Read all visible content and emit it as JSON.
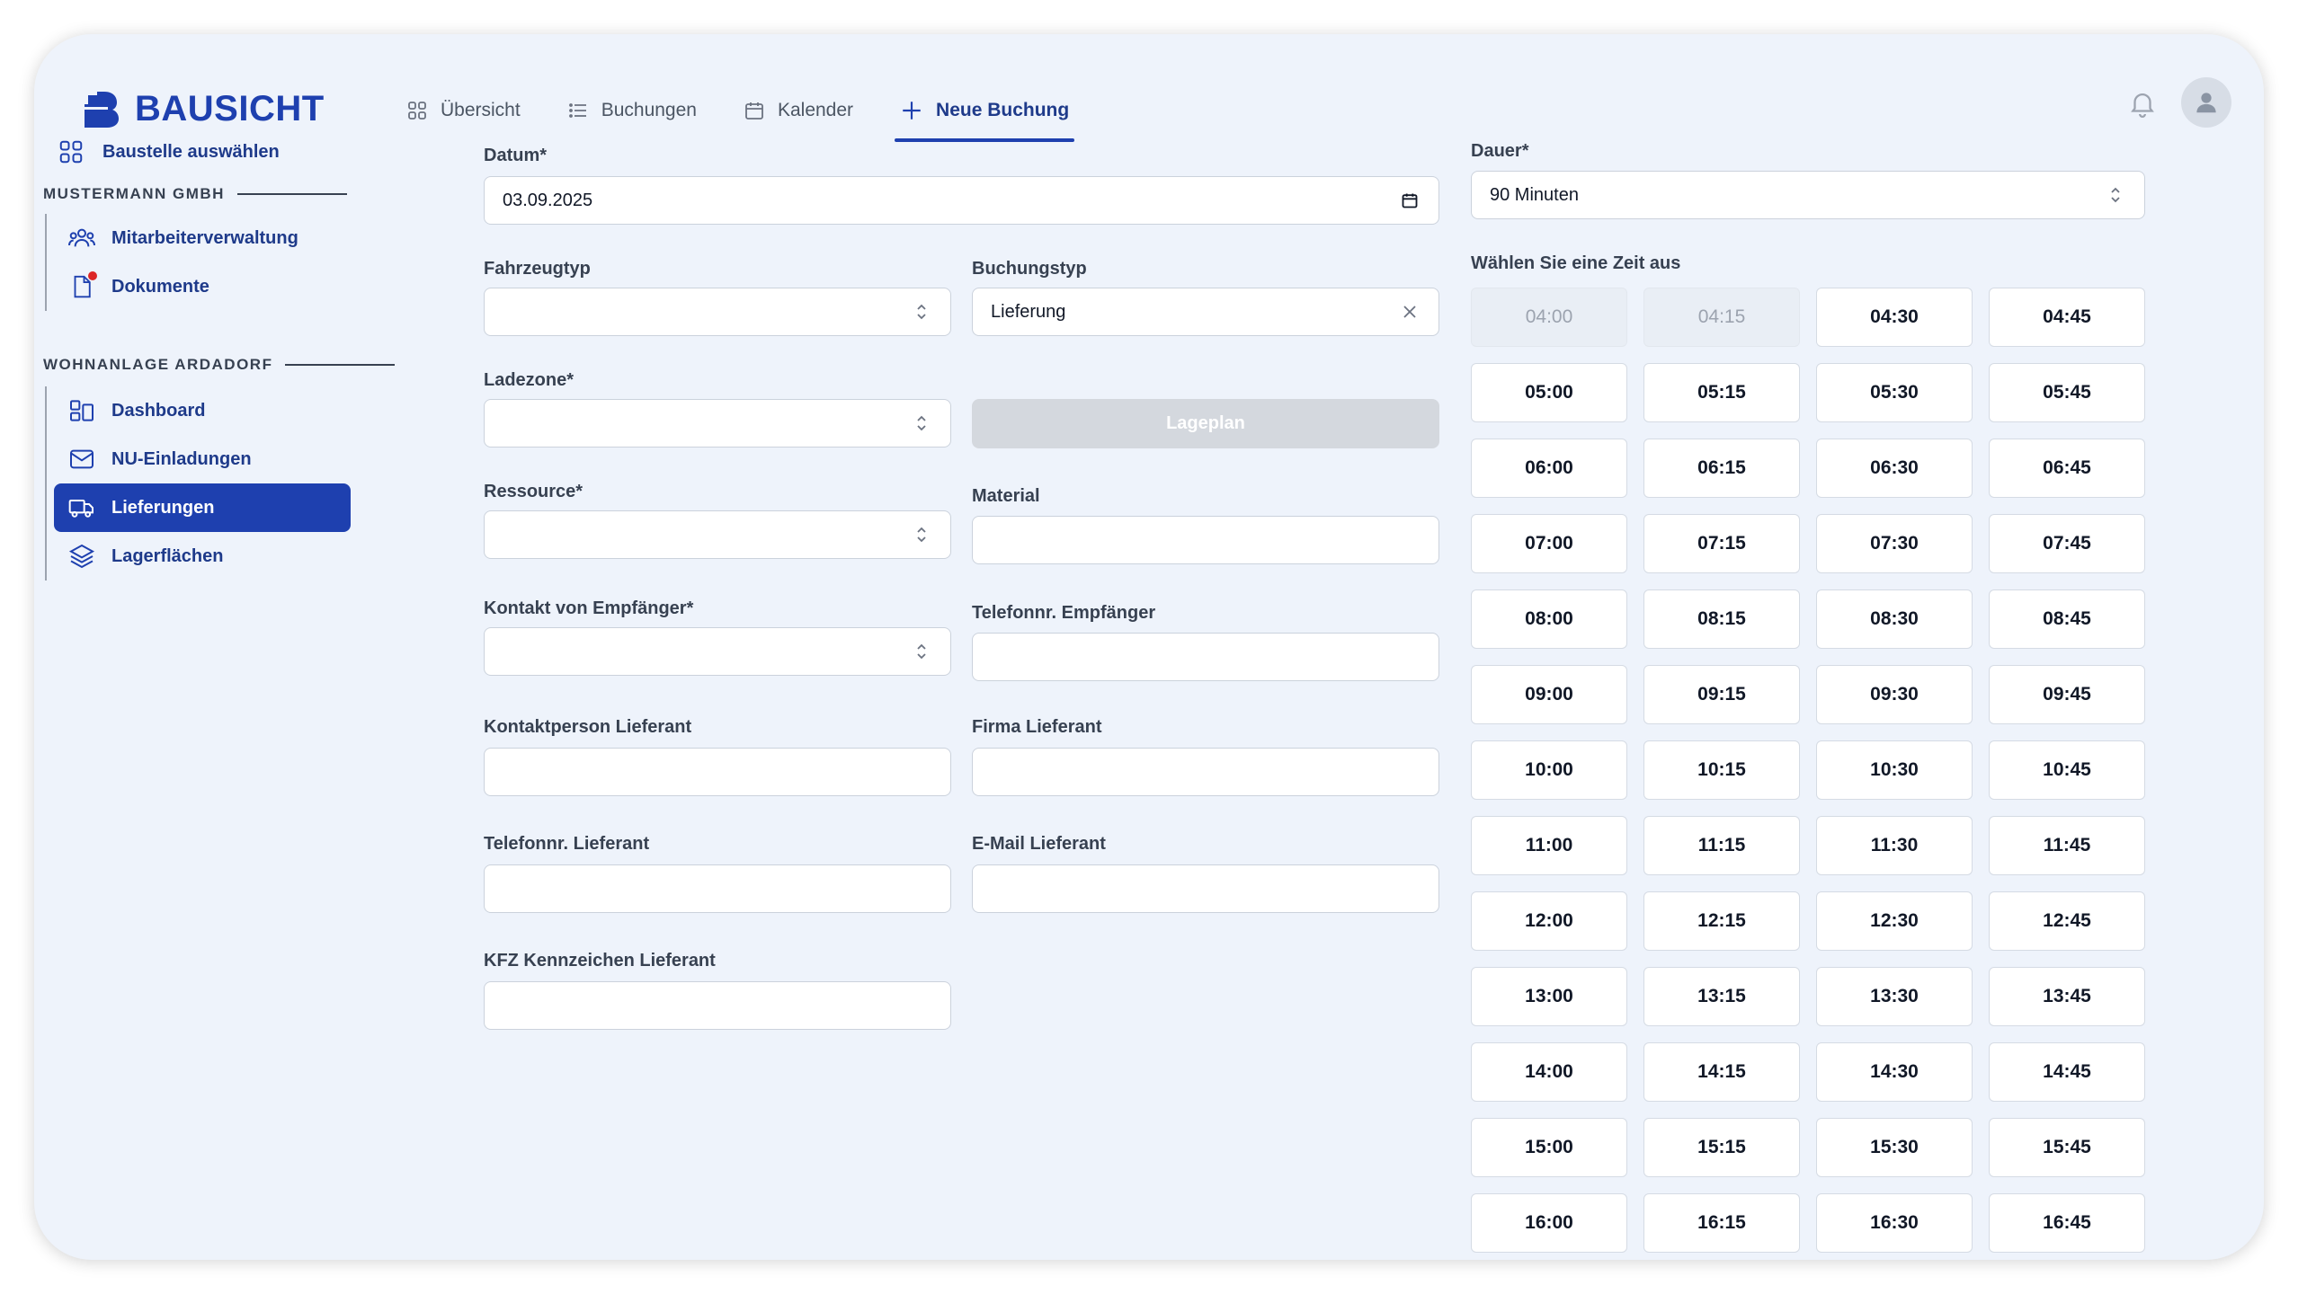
{
  "header": {
    "brand": "BAUSICHT",
    "tabs": [
      {
        "label": "Übersicht",
        "icon": "grid-icon"
      },
      {
        "label": "Buchungen",
        "icon": "list-icon"
      },
      {
        "label": "Kalender",
        "icon": "calendar-icon"
      },
      {
        "label": "Neue Buchung",
        "icon": "plus-icon",
        "active": true
      }
    ]
  },
  "sidebar": {
    "top_link": "Baustelle auswählen",
    "sections": [
      {
        "title": "MUSTERMANN GMBH",
        "items": [
          {
            "label": "Mitarbeiterverwaltung",
            "icon": "users-icon"
          },
          {
            "label": "Dokumente",
            "icon": "document-icon",
            "badge": true
          }
        ]
      },
      {
        "title": "WOHNANLAGE ARDADORF",
        "items": [
          {
            "label": "Dashboard",
            "icon": "dashboard-icon"
          },
          {
            "label": "NU-Einladungen",
            "icon": "mail-icon"
          },
          {
            "label": "Lieferungen",
            "icon": "truck-icon",
            "active": true
          },
          {
            "label": "Lagerflächen",
            "icon": "layers-icon"
          }
        ]
      }
    ]
  },
  "form": {
    "datum": {
      "label": "Datum*",
      "value": "03.09.2025"
    },
    "fahrzeugtyp": {
      "label": "Fahrzeugtyp",
      "value": ""
    },
    "buchungstyp": {
      "label": "Buchungstyp",
      "value": "Lieferung"
    },
    "ladezone": {
      "label": "Ladezone*",
      "value": ""
    },
    "lageplan_button": "Lageplan",
    "ressource": {
      "label": "Ressource*",
      "value": ""
    },
    "material": {
      "label": "Material",
      "value": ""
    },
    "kontakt_empfaenger": {
      "label": "Kontakt von Empfänger*",
      "value": ""
    },
    "telefon_empfaenger": {
      "label": "Telefonnr. Empfänger",
      "value": ""
    },
    "kontaktperson_lieferant": {
      "label": "Kontaktperson Lieferant",
      "value": ""
    },
    "firma_lieferant": {
      "label": "Firma Lieferant",
      "value": ""
    },
    "telefon_lieferant": {
      "label": "Telefonnr. Lieferant",
      "value": ""
    },
    "email_lieferant": {
      "label": "E-Mail Lieferant",
      "value": ""
    },
    "kfz_kennzeichen": {
      "label": "KFZ Kennzeichen Lieferant",
      "value": ""
    }
  },
  "schedule": {
    "dauer_label": "Dauer*",
    "dauer_value": "90 Minuten",
    "time_label": "Wählen Sie eine Zeit aus",
    "slots": [
      {
        "t": "04:00",
        "disabled": true
      },
      {
        "t": "04:15",
        "disabled": true
      },
      {
        "t": "04:30"
      },
      {
        "t": "04:45"
      },
      {
        "t": "05:00"
      },
      {
        "t": "05:15"
      },
      {
        "t": "05:30"
      },
      {
        "t": "05:45"
      },
      {
        "t": "06:00"
      },
      {
        "t": "06:15"
      },
      {
        "t": "06:30"
      },
      {
        "t": "06:45"
      },
      {
        "t": "07:00"
      },
      {
        "t": "07:15"
      },
      {
        "t": "07:30"
      },
      {
        "t": "07:45"
      },
      {
        "t": "08:00"
      },
      {
        "t": "08:15"
      },
      {
        "t": "08:30"
      },
      {
        "t": "08:45"
      },
      {
        "t": "09:00"
      },
      {
        "t": "09:15"
      },
      {
        "t": "09:30"
      },
      {
        "t": "09:45"
      },
      {
        "t": "10:00"
      },
      {
        "t": "10:15"
      },
      {
        "t": "10:30"
      },
      {
        "t": "10:45"
      },
      {
        "t": "11:00"
      },
      {
        "t": "11:15"
      },
      {
        "t": "11:30"
      },
      {
        "t": "11:45"
      },
      {
        "t": "12:00"
      },
      {
        "t": "12:15"
      },
      {
        "t": "12:30"
      },
      {
        "t": "12:45"
      },
      {
        "t": "13:00"
      },
      {
        "t": "13:15"
      },
      {
        "t": "13:30"
      },
      {
        "t": "13:45"
      },
      {
        "t": "14:00"
      },
      {
        "t": "14:15"
      },
      {
        "t": "14:30"
      },
      {
        "t": "14:45"
      },
      {
        "t": "15:00"
      },
      {
        "t": "15:15"
      },
      {
        "t": "15:30"
      },
      {
        "t": "15:45"
      },
      {
        "t": "16:00"
      },
      {
        "t": "16:15"
      },
      {
        "t": "16:30"
      },
      {
        "t": "16:45"
      }
    ]
  },
  "colors": {
    "primary": "#1e40af",
    "background": "#eef3fb",
    "badge": "#dc2626"
  }
}
